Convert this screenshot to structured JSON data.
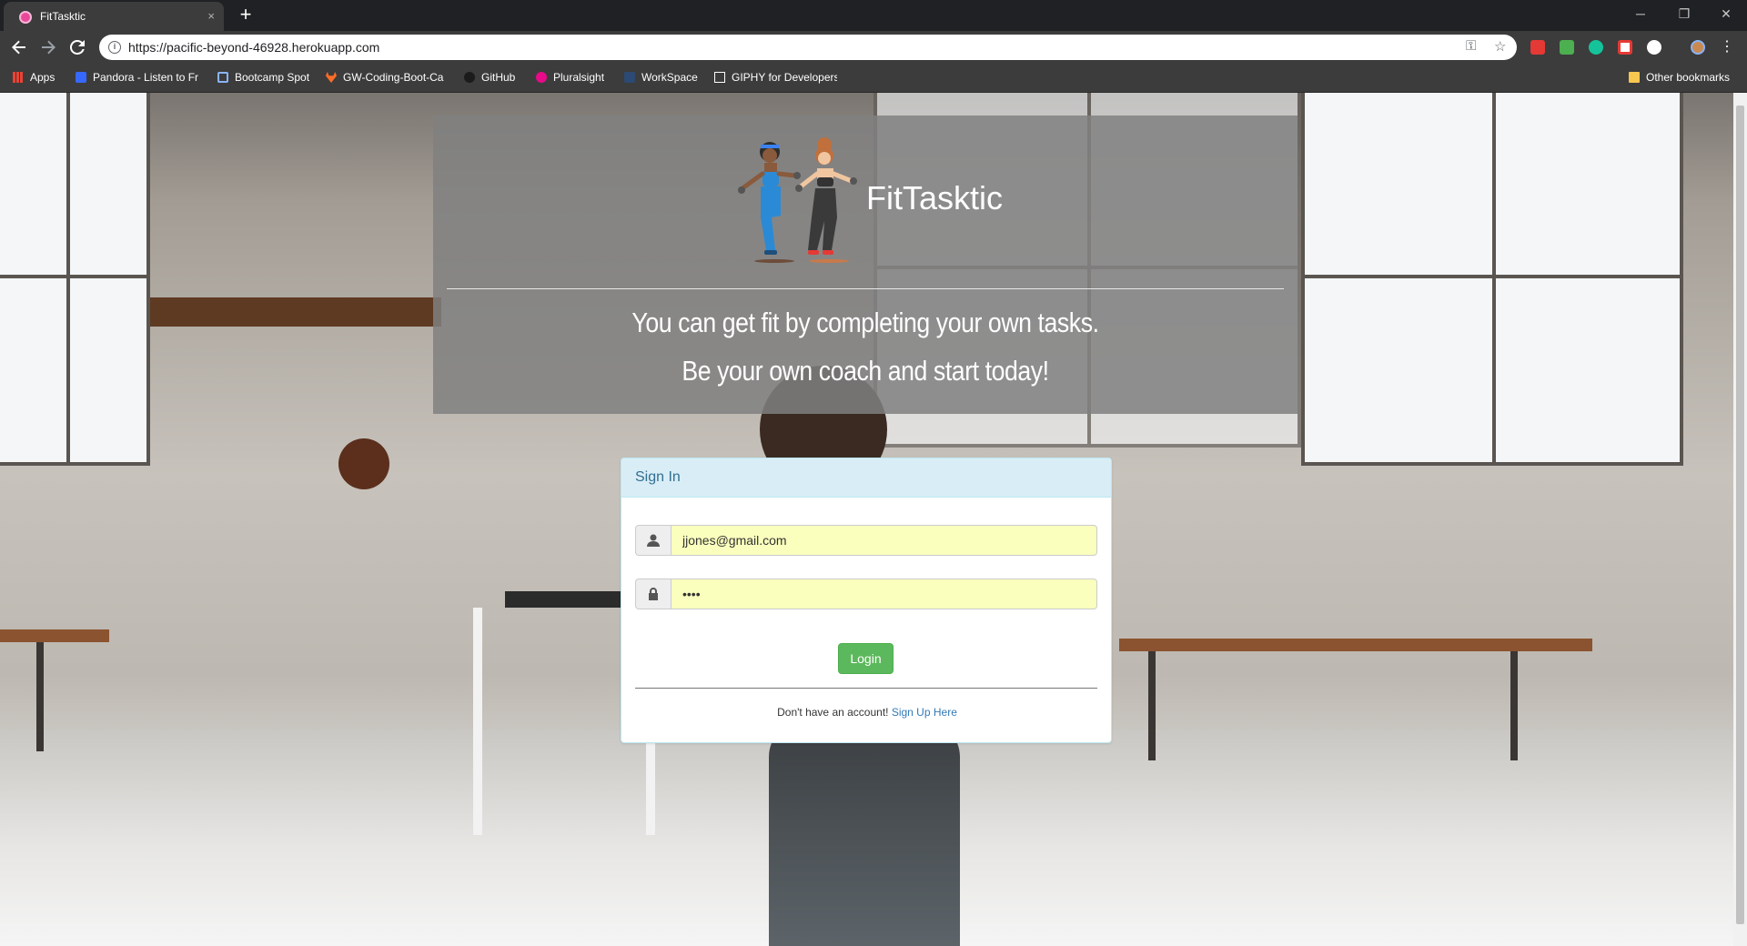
{
  "browser": {
    "tab_title": "FitTasktic",
    "tab_close": "×",
    "new_tab": "+",
    "url": "https://pacific-beyond-46928.herokuapp.com",
    "window_controls": {
      "minimize": "─",
      "restore": "❐",
      "close": "✕"
    },
    "bookmarks": [
      {
        "label": "Apps",
        "icon": "apps-grid-icon",
        "color": "#ea4335"
      },
      {
        "label": "Pandora - Listen to Fr",
        "icon": "pandora-icon",
        "color": "#3668ff"
      },
      {
        "label": "Bootcamp Spot",
        "icon": "bootcamp-shield-icon",
        "color": "#8ab4f8"
      },
      {
        "label": "GW-Coding-Boot-Ca",
        "icon": "gitlab-icon",
        "color": "#fc6d26"
      },
      {
        "label": "GitHub",
        "icon": "github-icon",
        "color": "#ffffff"
      },
      {
        "label": "Pluralsight",
        "icon": "pluralsight-icon",
        "color": "#e80a89"
      },
      {
        "label": "WorkSpace",
        "icon": "workspace-icon",
        "color": "#4a90e2"
      },
      {
        "label": "GIPHY for Developers",
        "icon": "giphy-icon",
        "color": "#ffffff"
      }
    ],
    "other_bookmarks": "Other bookmarks"
  },
  "hero": {
    "brand": "FitTasktic",
    "tagline_1": "You can get fit by completing your own tasks.",
    "tagline_2": "Be your own coach and start today!"
  },
  "signin": {
    "title": "Sign In",
    "email_value": "jjones@gmail.com",
    "password_value": "••••",
    "login_label": "Login",
    "no_account_text": "Don't have an account!",
    "signup_link": "Sign Up Here"
  },
  "colors": {
    "panel_heading_bg": "#d9edf7",
    "panel_heading_text": "#31708f",
    "login_green": "#5cb85c",
    "autofill_yellow": "#faffbd",
    "link_blue": "#337ab7"
  }
}
